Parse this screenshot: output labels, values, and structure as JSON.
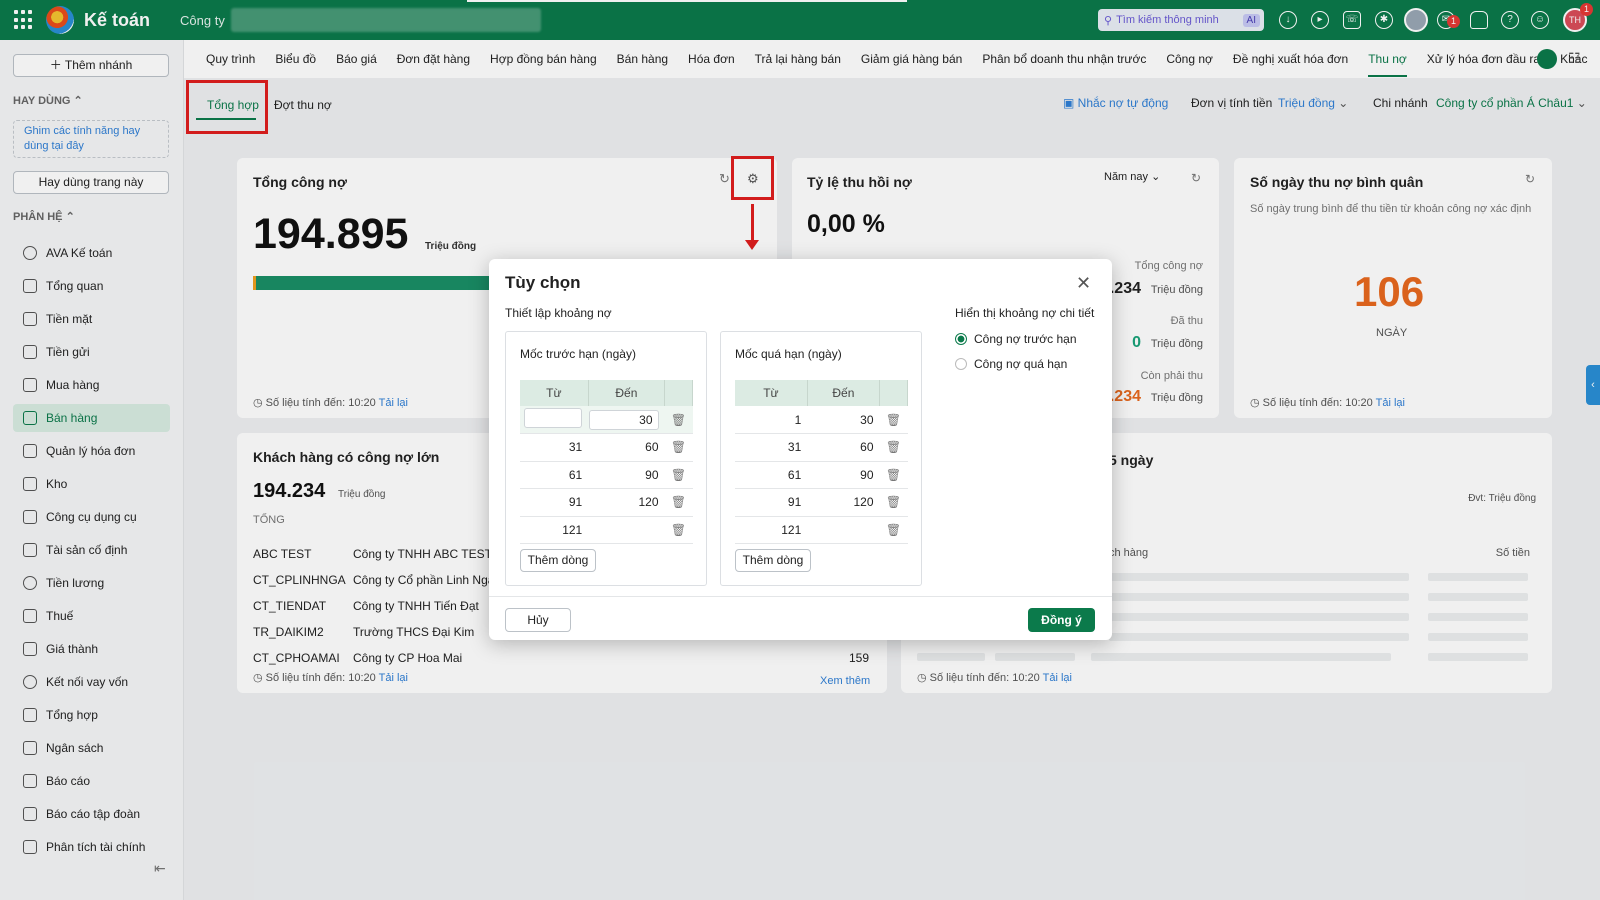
{
  "topbar": {
    "app_title": "Kế toán",
    "company_prefix": "Công ty",
    "search_placeholder": "Tìm kiếm thông minh",
    "search_ai": "AI",
    "chat_badge": "1",
    "avatar_badge": "1",
    "avatar_initials": "TH"
  },
  "menubar": {
    "items": [
      "Quy trình",
      "Biểu đồ",
      "Báo giá",
      "Đơn đặt hàng",
      "Hợp đồng bán hàng",
      "Bán hàng",
      "Hóa đơn",
      "Trả lại hàng bán",
      "Giảm giá hàng bán",
      "Phân bổ doanh thu nhận trước",
      "Công nợ",
      "Đề nghị xuất hóa đơn",
      "Thu nợ",
      "Xử lý hóa đơn đầu ra",
      "Khác"
    ],
    "active": "Thu nợ"
  },
  "sidebar": {
    "add_branch": "Thêm nhánh",
    "frequent_header": "HAY DÙNG",
    "pin_hint": "Ghim các tính năng hay dùng tại đây",
    "use_page": "Hay dùng trang này",
    "modules_header": "PHÂN HỆ",
    "items": [
      "AVA Kế toán",
      "Tổng quan",
      "Tiền mặt",
      "Tiền gửi",
      "Mua hàng",
      "Bán hàng",
      "Quản lý hóa đơn",
      "Kho",
      "Công cụ dụng cụ",
      "Tài sản cố định",
      "Tiền lương",
      "Thuế",
      "Giá thành",
      "Kết nối vay vốn",
      "Tổng hợp",
      "Ngân sách",
      "Báo cáo",
      "Báo cáo tập đoàn",
      "Phân tích tài chính"
    ],
    "active": "Bán hàng"
  },
  "subtabs": {
    "tab1": "Tổng hợp",
    "tab2": "Đợt thu nợ",
    "auto_remind": "Nhắc nợ tự động",
    "unit_label": "Đơn vị tính tiền",
    "unit_value": "Triệu đồng",
    "branch_label": "Chi nhánh",
    "branch_value": "Công ty cổ phần Á Châu1"
  },
  "cards": {
    "total_debt": {
      "title": "Tổng công nợ",
      "value": "194.895",
      "unit": "Triệu đồng",
      "footer": "Số liệu tính đến: 10:20",
      "reload": "Tải lại"
    },
    "recovery": {
      "title": "Tỷ lệ thu hồi nợ",
      "value": "0,00 %",
      "period": "Năm nay",
      "total_label": "Tổng công nợ",
      "total_value": ".234",
      "paid_label": "Đã thu",
      "paid_value": "0",
      "remain_label": "Còn phải thu",
      "remain_value": ".234",
      "unit": "Triệu đồng"
    },
    "avg_days": {
      "title": "Số ngày thu nợ bình quân",
      "desc": "Số ngày trung bình để thu tiền từ khoản công nợ xác định",
      "value": "106",
      "unit": "NGÀY",
      "footer": "Số liệu tính đến: 10:20",
      "reload": "Tải lại"
    },
    "big_customers": {
      "title": "Khách hàng có công nợ lớn",
      "value": "194.234",
      "unit": "Triệu đồng",
      "total_label": "TỔNG",
      "rows": [
        {
          "code": "ABC TEST",
          "name": "Công ty TNHH ABC TEST"
        },
        {
          "code": "CT_CPLINHNGA",
          "name": "Công ty Cổ phần Linh Nga"
        },
        {
          "code": "CT_TIENDAT",
          "name": "Công ty TNHH Tiến Đạt"
        },
        {
          "code": "TR_DAIKIM2",
          "name": "Trường THCS Đại Kim"
        },
        {
          "code": "CT_CPHOAMAI",
          "name": "Công ty CP Hoa Mai",
          "amount": "159"
        }
      ],
      "footer": "Số liệu tính đến: 10:20",
      "reload": "Tải lại",
      "more": "Xem thêm"
    },
    "days5": {
      "title_tail": "5 ngày",
      "unit_note": "Đvt: Triệu đồng",
      "col_customer": "ch hàng",
      "col_amount": "Số tiền",
      "footer": "Số liệu tính đến: 10:20",
      "reload": "Tải lại"
    }
  },
  "modal": {
    "title": "Tùy chọn",
    "section": "Thiết lập khoảng nợ",
    "before_title": "Mốc trước hạn (ngày)",
    "overdue_title": "Mốc quá hạn (ngày)",
    "col_from": "Từ",
    "col_to": "Đến",
    "before_rows": [
      [
        "",
        "30"
      ],
      [
        "31",
        "60"
      ],
      [
        "61",
        "90"
      ],
      [
        "91",
        "120"
      ],
      [
        "121",
        ""
      ]
    ],
    "overdue_rows": [
      [
        "1",
        "30"
      ],
      [
        "31",
        "60"
      ],
      [
        "61",
        "90"
      ],
      [
        "91",
        "120"
      ],
      [
        "121",
        ""
      ]
    ],
    "add_row": "Thêm dòng",
    "display_title": "Hiển thị khoảng nợ chi tiết",
    "option_before": "Công nợ trước hạn",
    "option_overdue": "Công nợ quá hạn",
    "selected": "Công nợ trước hạn",
    "cancel": "Hủy",
    "ok": "Đồng ý"
  },
  "colors": {
    "brand": "#0b7a4b",
    "link": "#2f7fd6",
    "accent_orange": "#e8691e",
    "highlight": "#e01e1e"
  }
}
